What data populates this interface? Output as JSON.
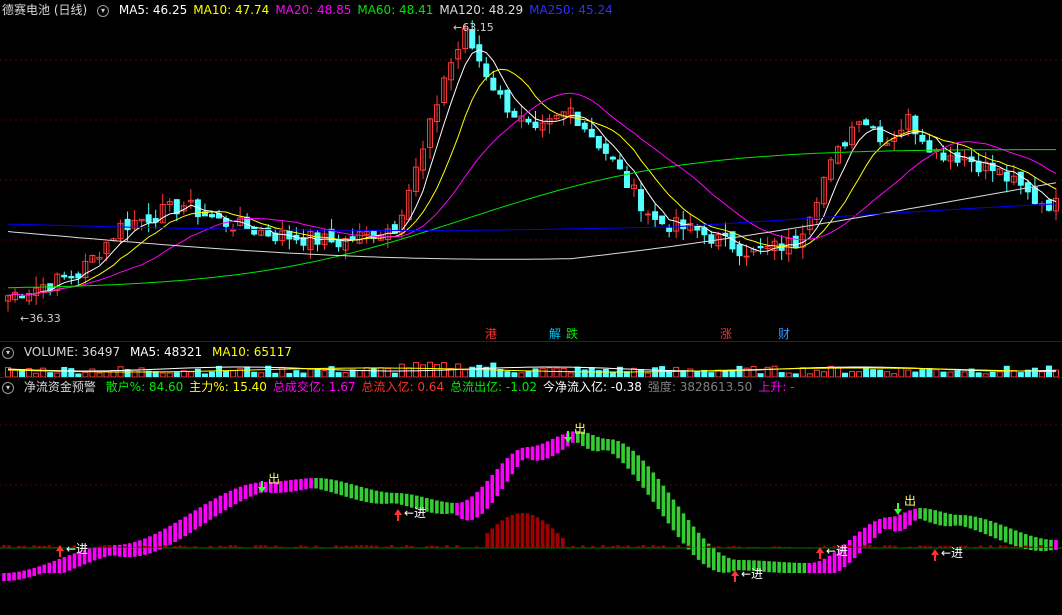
{
  "colors": {
    "bg": "#000000",
    "up": "#ff3a3a",
    "down": "#54ffff",
    "ma5": "#ffffff",
    "ma10": "#ffff00",
    "ma20": "#ff00ff",
    "ma60": "#00e600",
    "ma120": "#dcdcdc",
    "ma250": "#0000ff",
    "magenta": "#ff00ff",
    "green": "#33cc33",
    "darkred": "#a00000"
  },
  "main": {
    "title": "德赛电池 (日线)",
    "toggle_icon": "chevron-down-icon",
    "ma": [
      {
        "label": "MA5: 46.25",
        "color": "#ffffff"
      },
      {
        "label": "MA10: 47.74",
        "color": "#ffff00"
      },
      {
        "label": "MA20: 48.85",
        "color": "#ff00ff"
      },
      {
        "label": "MA60: 48.41",
        "color": "#00e600"
      },
      {
        "label": "MA120: 48.29",
        "color": "#dcdcdc"
      },
      {
        "label": "MA250: 45.24",
        "color": "#3030ff"
      }
    ],
    "high_label": "63.15",
    "low_label": "36.33",
    "events": [
      {
        "text": "港",
        "color": "#ff3030"
      },
      {
        "text": "解",
        "color": "#00ccff"
      },
      {
        "text": "跌",
        "color": "#00ee00"
      },
      {
        "text": "涨",
        "color": "#ff3030"
      },
      {
        "text": "财",
        "color": "#3399ff"
      }
    ]
  },
  "volume": {
    "title": "VOLUME: 36497",
    "ma5": "MA5: 48321",
    "ma10": "MA10: 65117"
  },
  "indicator": {
    "title": "净流资金预警",
    "fields": [
      {
        "label": "散户%: 84.60",
        "color": "#00ee00"
      },
      {
        "label": "主力%: 15.40",
        "color": "#ffff00"
      },
      {
        "label": "总成交亿: 1.67",
        "color": "#ff00ff"
      },
      {
        "label": "总流入亿: 0.64",
        "color": "#ff3030"
      },
      {
        "label": "总流出亿: -1.02",
        "color": "#00ee00"
      },
      {
        "label": "今净流入亿: -0.38",
        "color": "#ffffff"
      },
      {
        "label": "强度: 3828613.50",
        "color": "#808080"
      },
      {
        "label": "上升: -",
        "color": "#ff00ff"
      }
    ],
    "signals": [
      {
        "text": "进",
        "kind": "in"
      },
      {
        "text": "出",
        "kind": "out"
      },
      {
        "text": "进",
        "kind": "in"
      },
      {
        "text": "出",
        "kind": "out"
      },
      {
        "text": "进",
        "kind": "in"
      },
      {
        "text": "进",
        "kind": "in"
      },
      {
        "text": "出",
        "kind": "out"
      },
      {
        "text": "进",
        "kind": "in"
      }
    ]
  }
}
